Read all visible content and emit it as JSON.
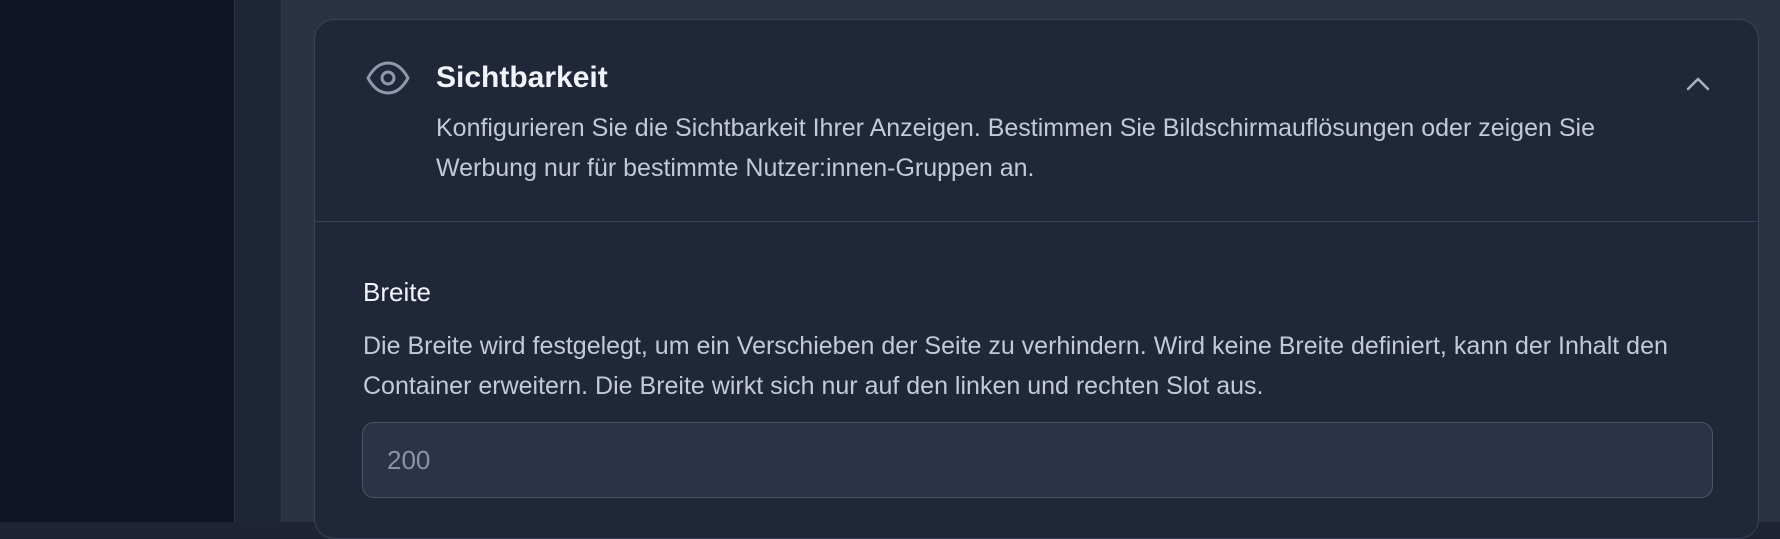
{
  "visibility_section": {
    "title": "Sichtbarkeit",
    "description": "Konfigurieren Sie die Sichtbarkeit Ihrer Anzeigen. Bestimmen Sie Bildschirmauflösungen oder zeigen Sie Werbung nur für bestimmte Nutzer:innen-Gruppen an.",
    "icon": "eye-icon",
    "collapse_icon": "chevron-up-icon",
    "expanded": true
  },
  "width_field": {
    "label": "Breite",
    "help": "Die Breite wird festgelegt, um ein Verschieben der Seite zu verhindern. Wird keine Breite definiert, kann der Inhalt den Container erweitern. Die Breite wirkt sich nur auf den linken und rechten Slot aus.",
    "placeholder": "200",
    "value": ""
  },
  "colors": {
    "sidebar": "#0f1527",
    "panel": "#1f2739",
    "input": "#2b3446",
    "text": "#f1f4f9",
    "muted_text": "#c3cad6"
  }
}
